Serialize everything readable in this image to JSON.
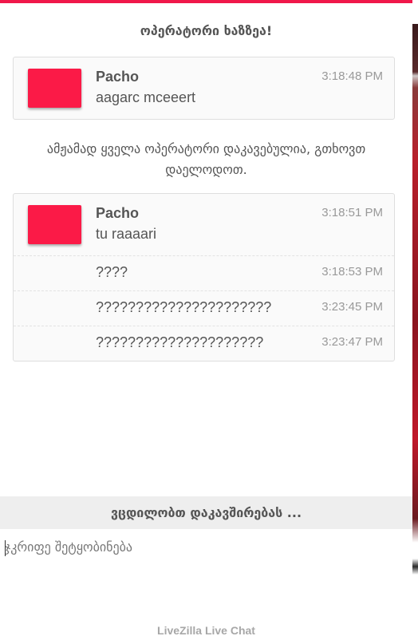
{
  "colors": {
    "accent": "#f0184a",
    "avatar": "#fb1a47"
  },
  "notices": {
    "operator_online": "ოპერატორი ხაზზეა!",
    "all_busy": "ამჟამად ყველა ოპერატორი დაკავებულია, გთხოვთ დაელოდოთ."
  },
  "groups": [
    {
      "sender": "Pacho",
      "avatar_icon": "avatar-icon",
      "messages": [
        {
          "text": "aagarc mceeert",
          "time": "3:18:48 PM"
        }
      ]
    },
    {
      "sender": "Pacho",
      "avatar_icon": "avatar-icon",
      "messages": [
        {
          "text": "tu raaaari",
          "time": "3:18:51 PM"
        },
        {
          "text": "????",
          "time": "3:18:53 PM"
        },
        {
          "text": "??????????????????????",
          "time": "3:23:45 PM"
        },
        {
          "text": "?????????????????????",
          "time": "3:23:47 PM"
        }
      ]
    }
  ],
  "status": "ვცდილობთ დაკავშირებას ...",
  "input": {
    "placeholder": "ჯკრიფე შეტყობინება",
    "value": ""
  },
  "footer": "LiveZilla Live Chat"
}
